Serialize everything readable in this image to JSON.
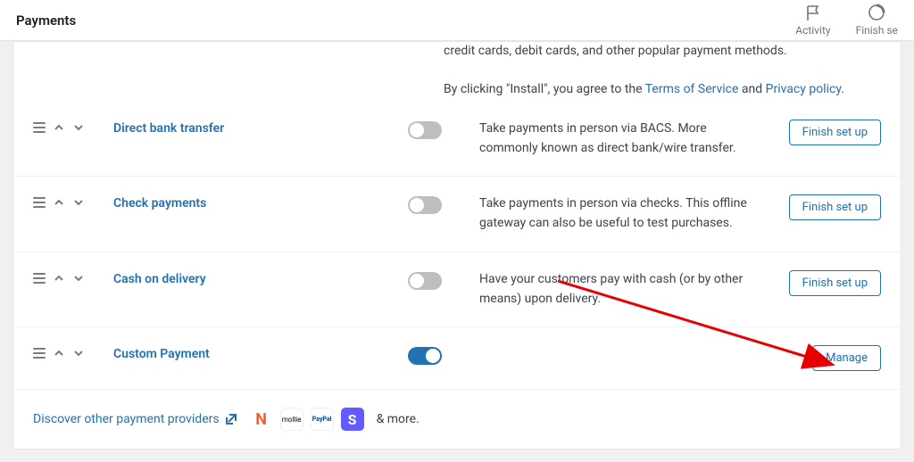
{
  "header": {
    "title": "Payments",
    "activity": "Activity",
    "finish_setup": "Finish se"
  },
  "partial_top": {
    "desc_line1": "credit cards, debit cards, and other popular payment methods.",
    "desc_prefix": "By clicking \"Install\", you agree to the ",
    "terms": "Terms of Service",
    "and": " and ",
    "privacy": "Privacy policy",
    "period": "."
  },
  "methods": [
    {
      "title": "Direct bank transfer",
      "desc": "Take payments in person via BACS. More commonly known as direct bank/wire transfer.",
      "action": "Finish set up",
      "enabled": false
    },
    {
      "title": "Check payments",
      "desc": "Take payments in person via checks. This offline gateway can also be useful to test purchases.",
      "action": "Finish set up",
      "enabled": false
    },
    {
      "title": "Cash on delivery",
      "desc": "Have your customers pay with cash (or by other means) upon delivery.",
      "action": "Finish set up",
      "enabled": false
    },
    {
      "title": "Custom Payment",
      "desc": "",
      "action": "Manage",
      "enabled": true
    }
  ],
  "discover": {
    "link": "Discover other payment providers",
    "more": "& more."
  }
}
